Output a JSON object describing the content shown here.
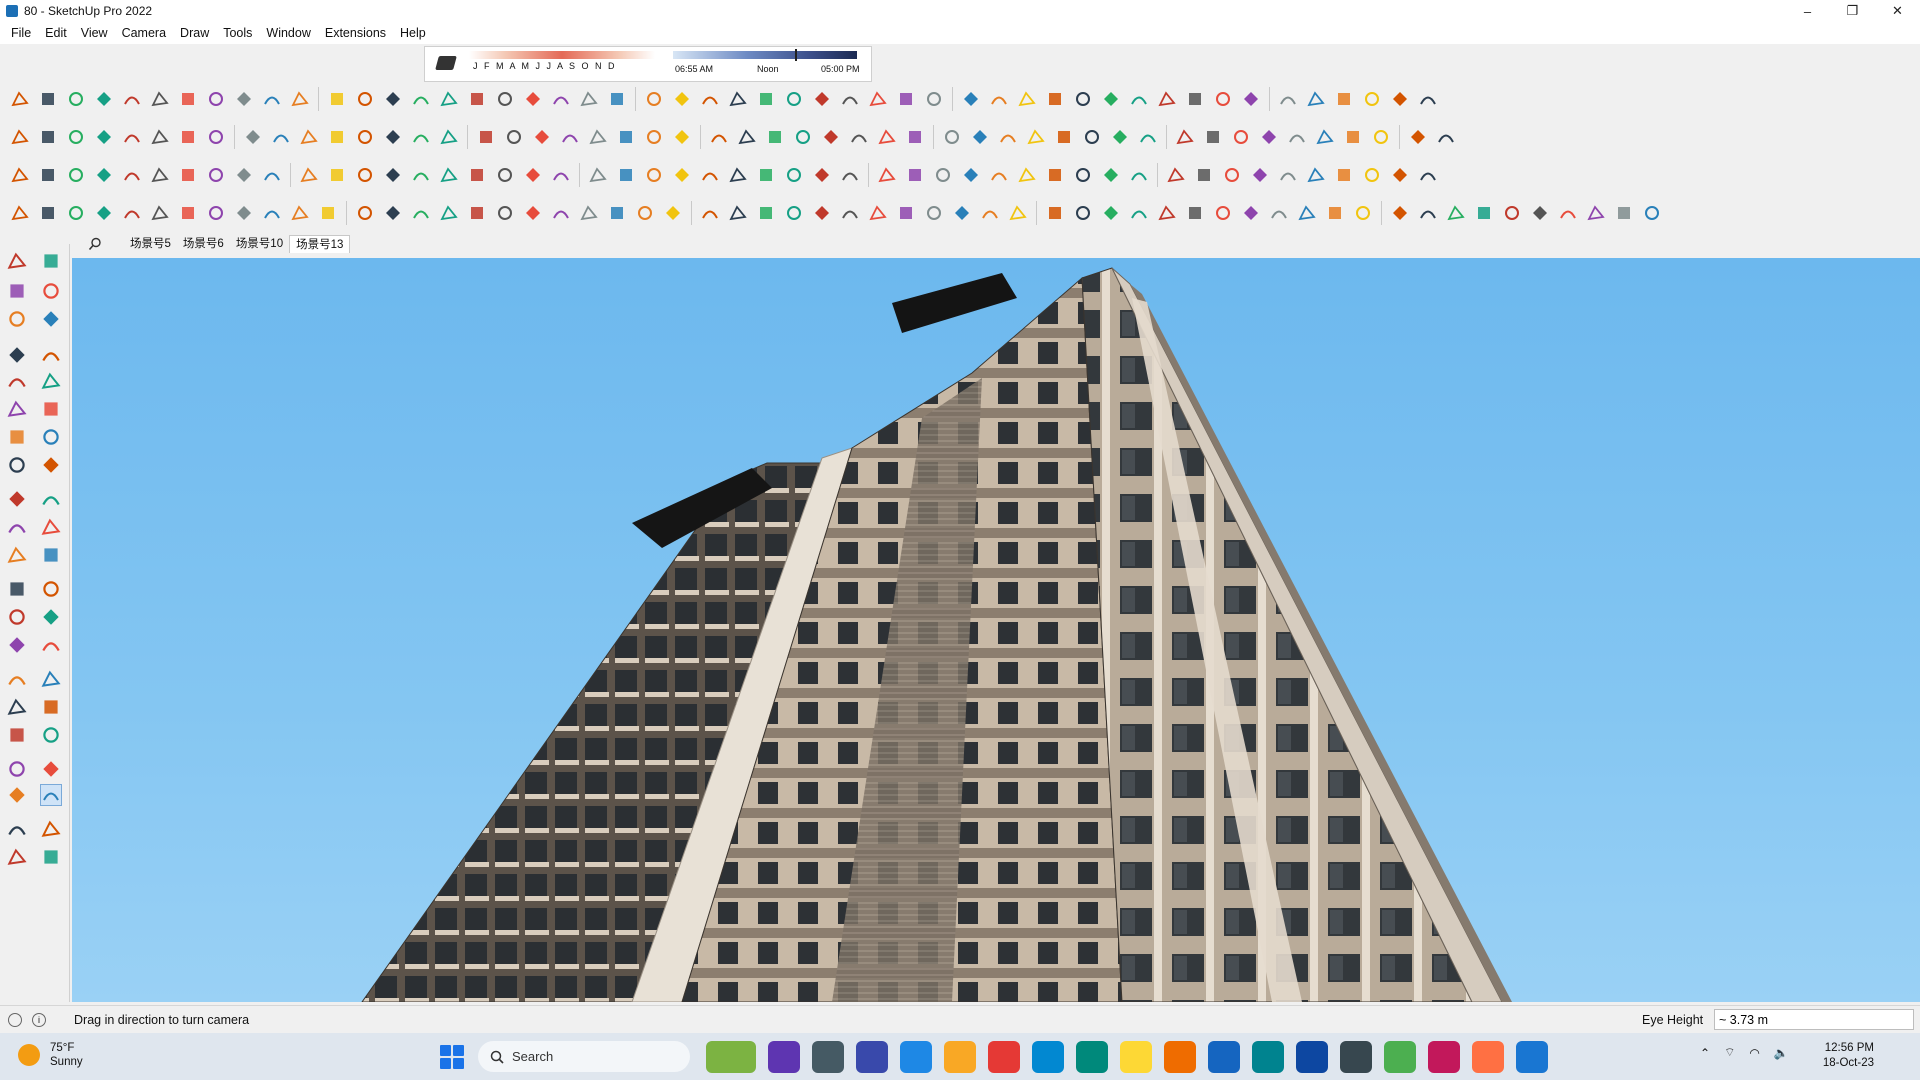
{
  "window": {
    "title": "80 - SketchUp Pro 2022",
    "controls": [
      "–",
      "❐",
      "✕"
    ]
  },
  "menu": [
    "File",
    "Edit",
    "View",
    "Camera",
    "Draw",
    "Tools",
    "Window",
    "Extensions",
    "Help"
  ],
  "shadows": {
    "months": "J F M A M J J A S O N D",
    "time_start": "06:55 AM",
    "time_mid": "Noon",
    "time_end": "05:00 PM"
  },
  "scenes": {
    "tabs": [
      "场景号5",
      "场景号6",
      "场景号10",
      "场景号13"
    ],
    "active_index": 3
  },
  "status": {
    "message": "Drag in direction to turn camera",
    "measure_label": "Eye Height",
    "measure_value": "~ 3.73 m"
  },
  "taskbar": {
    "weather_temp": "75°F",
    "weather_desc": "Sunny",
    "search_placeholder": "Search",
    "time": "12:56 PM",
    "date": "18-Oct-23"
  },
  "colors": {
    "sky_top": "#6cb8ee",
    "facade": "#c9bba9",
    "facade_dark": "#8b7e70",
    "window": "#2e3338",
    "accent_blue": "#1a73e8"
  }
}
